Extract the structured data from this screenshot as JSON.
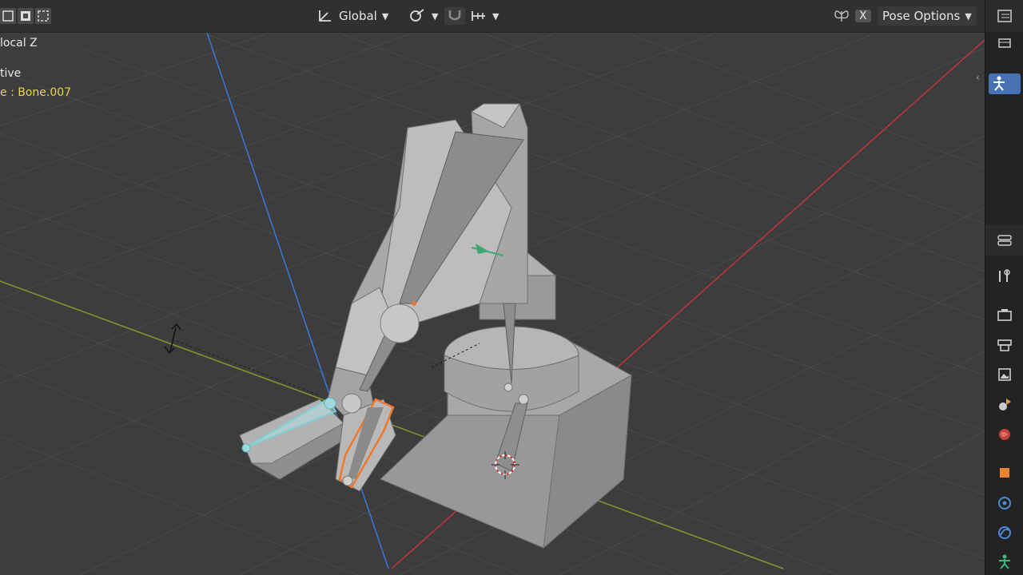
{
  "header": {
    "transform_orientation": "Global",
    "pose_options_label": "Pose Options",
    "x_mirror_label": "X"
  },
  "overlay": {
    "line1": "local Z",
    "line2": "tive",
    "line3": "e : Bone.007"
  },
  "icons": {
    "select_modes": [
      "select-box-icon",
      "select-extend-icon",
      "select-subtract-icon"
    ],
    "transform": "orientation-axes-icon",
    "pivot": "pivot-link-icon",
    "snap": "snap-magnet-icon",
    "proportional": "proportional-icon",
    "mirror": "butterfly-icon",
    "sidebar": [
      "outliner-editor-icon",
      "object-mode-icon",
      "pose-active-icon",
      "properties-editor-icon",
      "tool-icon",
      "render-icon",
      "output-icon",
      "view-layer-icon",
      "scene-icon",
      "world-icon",
      "object-icon",
      "modifier-icon",
      "physics-icon",
      "armature-data-icon"
    ]
  },
  "colors": {
    "viewport_bg": "#3d3d3d",
    "grid": "#484848",
    "x_axis": "#c3343f",
    "y_axis": "#7f9a2e",
    "z_axis": "#3b78d8",
    "selected_bone": "#f0782a",
    "ik_bone": "#7fd0d6",
    "active_sidebar": "#4772b3"
  }
}
